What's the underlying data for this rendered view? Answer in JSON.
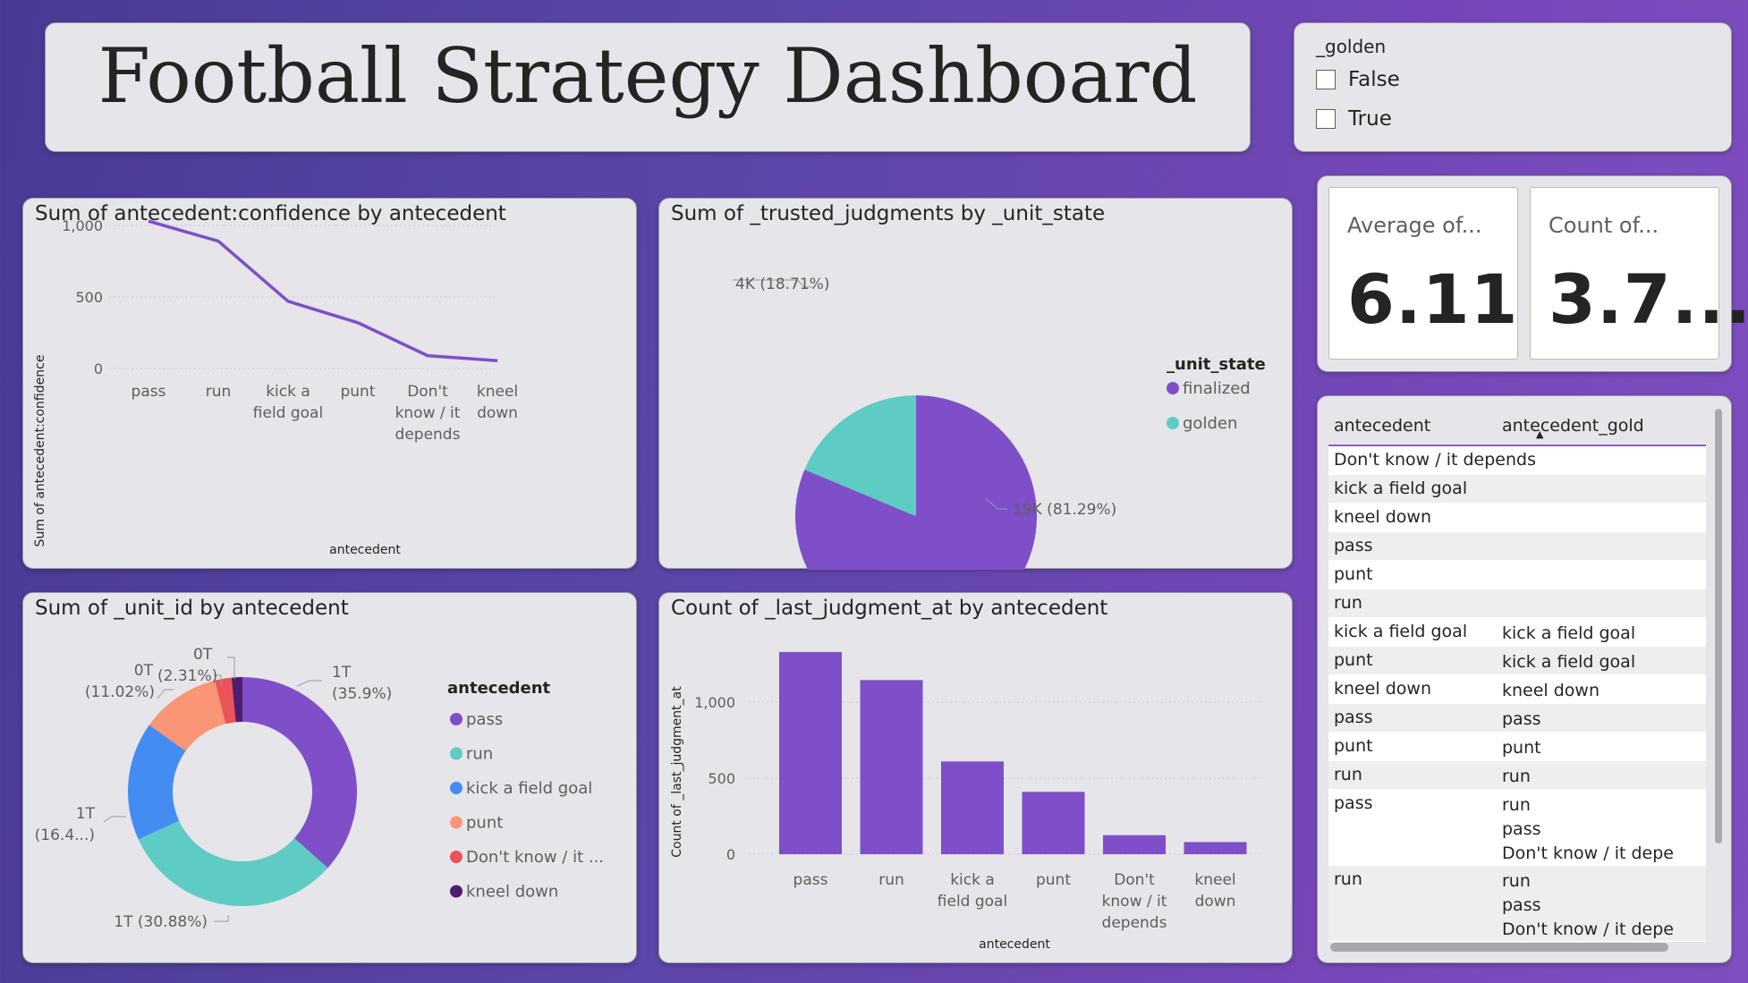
{
  "title": "Football Strategy Dashboard",
  "slicer": {
    "header": "_golden",
    "options": [
      "False",
      "True"
    ]
  },
  "kpis": [
    {
      "label": "Average of...",
      "value": "6.11"
    },
    {
      "label": "Count of...",
      "value": "3.7..."
    }
  ],
  "line_chart": {
    "title": "Sum of antecedent:confidence by antecedent",
    "ylabel": "Sum of antecedent:confidence",
    "xlabel": "antecedent",
    "yticks": [
      "1,000",
      "500",
      "0"
    ],
    "categories": [
      "pass",
      "run",
      "kick a field goal",
      "punt",
      "Don't know / it depends",
      "kneel down"
    ],
    "color": "#7e4fc8"
  },
  "pie_chart": {
    "title": "Sum of _trusted_judgments by _unit_state",
    "legend_title": "_unit_state",
    "labels": [
      "4K (18.71%)",
      "19K (81.29%)"
    ]
  },
  "donut_chart": {
    "title": "Sum of _unit_id by antecedent",
    "legend_title": "antecedent",
    "labels": {
      "pass": [
        "1T",
        "(35.9%)"
      ],
      "run": "1T (30.88%)",
      "kick": [
        "1T",
        "(16.4...)"
      ],
      "punt": [
        "0T",
        "(11.02%)"
      ],
      "dk": [
        "0T",
        "(2.31%)"
      ],
      "kneel": "0T"
    },
    "legend": [
      "pass",
      "run",
      "kick a field goal",
      "punt",
      "Don't know / it ...",
      "kneel down"
    ]
  },
  "bar_chart": {
    "title": "Count of _last_judgment_at by antecedent",
    "ylabel": "Count of _last_judgment_at",
    "xlabel": "antecedent",
    "yticks": [
      "1,000",
      "500",
      "0"
    ]
  },
  "chart_data": [
    {
      "type": "line",
      "title": "Sum of antecedent:confidence by antecedent",
      "xlabel": "antecedent",
      "ylabel": "Sum of antecedent:confidence",
      "categories": [
        "pass",
        "run",
        "kick a field goal",
        "punt",
        "Don't know / it depends",
        "kneel down"
      ],
      "values": [
        1030,
        890,
        470,
        320,
        90,
        55
      ],
      "ylim": [
        0,
        1100
      ],
      "grid": true
    },
    {
      "type": "pie",
      "title": "Sum of _trusted_judgments by _unit_state",
      "legend_title": "_unit_state",
      "categories": [
        "finalized",
        "golden"
      ],
      "values": [
        81.29,
        18.71
      ],
      "colors": [
        "#7e4fc8",
        "#5ecbc5"
      ],
      "legend_position": "right"
    },
    {
      "type": "pie",
      "title": "Sum of _unit_id by antecedent",
      "legend_title": "antecedent",
      "categories": [
        "pass",
        "run",
        "kick a field goal",
        "punt",
        "Don't know / it depends",
        "kneel down"
      ],
      "values": [
        35.9,
        30.88,
        16.4,
        11.02,
        2.31,
        1.49
      ],
      "colors": [
        "#7e4fc8",
        "#5ecbc5",
        "#448cf2",
        "#fa9576",
        "#ea5359",
        "#4e1e6c"
      ],
      "legend_position": "right"
    },
    {
      "type": "bar",
      "title": "Count of _last_judgment_at by antecedent",
      "xlabel": "antecedent",
      "ylabel": "Count of _last_judgment_at",
      "categories": [
        "pass",
        "run",
        "kick a field goal",
        "punt",
        "Don't know / it depends",
        "kneel down"
      ],
      "values": [
        1330,
        1145,
        610,
        410,
        125,
        80
      ],
      "ylim": [
        0,
        1400
      ],
      "grid": true
    }
  ],
  "table": {
    "columns": [
      "antecedent",
      "antecedent_gold"
    ],
    "rows": [
      {
        "a": "Don't know / it depends",
        "g": []
      },
      {
        "a": "kick a field goal",
        "g": []
      },
      {
        "a": "kneel down",
        "g": []
      },
      {
        "a": "pass",
        "g": []
      },
      {
        "a": "punt",
        "g": []
      },
      {
        "a": "run",
        "g": []
      },
      {
        "a": "kick a field goal",
        "g": [
          "kick a field goal"
        ]
      },
      {
        "a": "punt",
        "g": [
          "kick a field goal"
        ]
      },
      {
        "a": "kneel down",
        "g": [
          "kneel down"
        ]
      },
      {
        "a": "pass",
        "g": [
          "pass"
        ]
      },
      {
        "a": "punt",
        "g": [
          "punt"
        ]
      },
      {
        "a": "run",
        "g": [
          "run"
        ]
      },
      {
        "a": "pass",
        "g": [
          "run",
          "pass",
          "Don't know / it depe"
        ]
      },
      {
        "a": "run",
        "g": [
          "run",
          "pass",
          "Don't know / it depe"
        ]
      }
    ]
  }
}
